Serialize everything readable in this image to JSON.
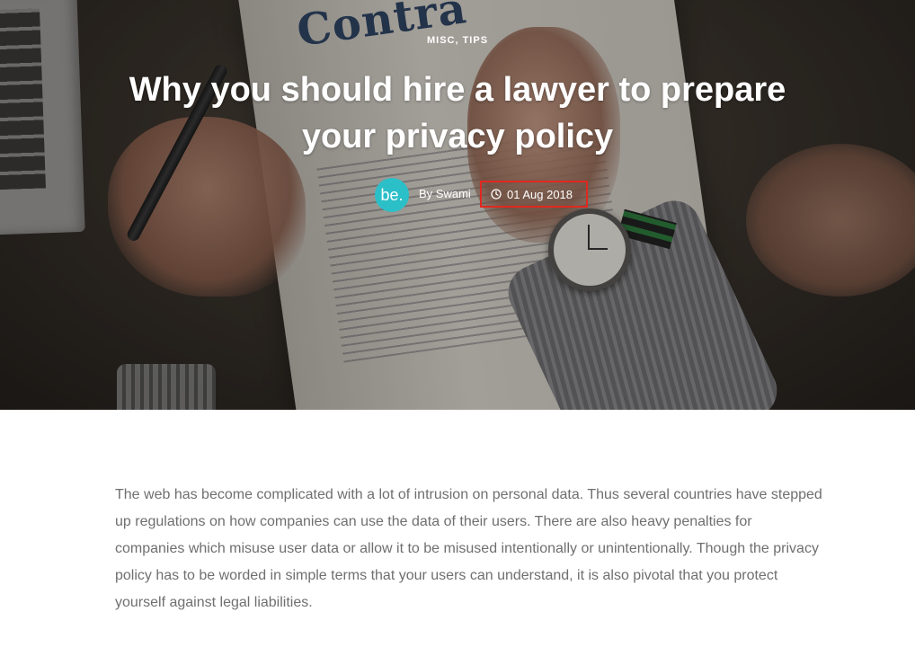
{
  "post": {
    "categories": "MISC, TIPS",
    "title": "Why you should hire a lawyer to prepare your privacy policy",
    "author_avatar_text": "be.",
    "author": "By Swami",
    "date": "01 Aug 2018",
    "hero_image_text": "Contra"
  },
  "article": {
    "paragraph_1": "The web has become complicated with a lot of intrusion on personal data. Thus several countries have stepped up regulations on how companies can use the data of their users. There are also heavy penalties for companies which misuse user data or allow it to be misused intentionally or unintentionally. Though the privacy policy has to be worded in simple terms that your users can understand, it is also pivotal that you protect yourself against legal liabilities."
  },
  "colors": {
    "avatar_bg": "#2bbfc8",
    "highlight_border": "#e0281f",
    "body_text": "#6f6f6f"
  },
  "icons": {
    "date": "clock-icon"
  }
}
